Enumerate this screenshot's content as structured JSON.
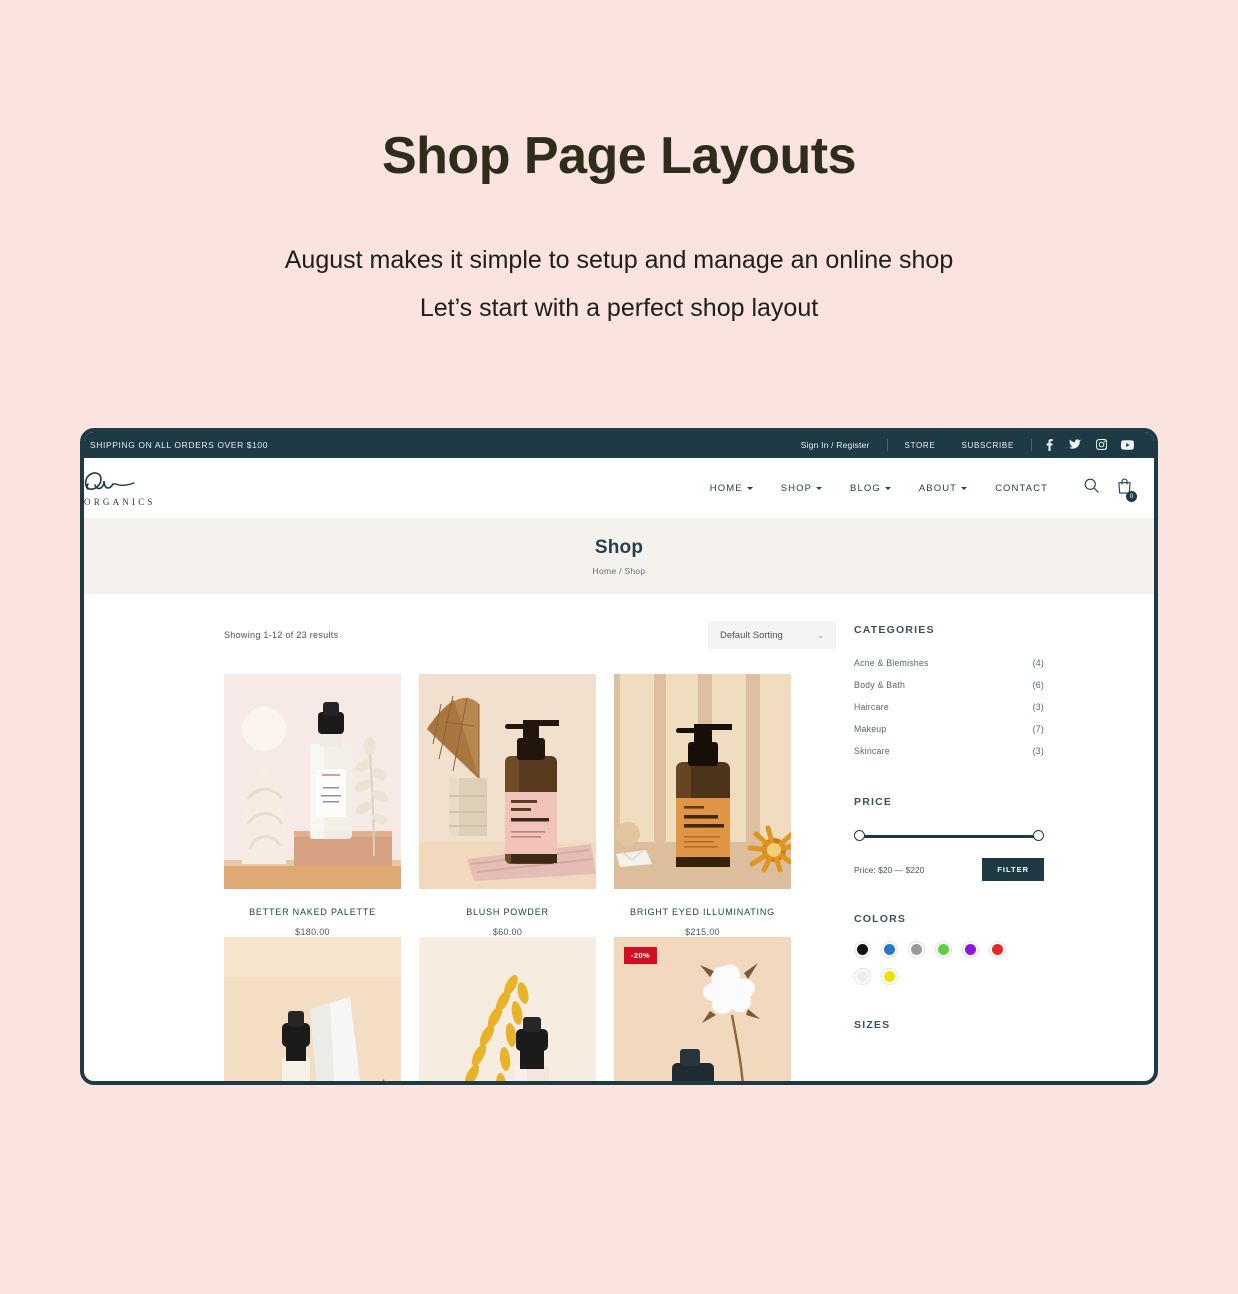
{
  "promo": {
    "title": "Shop Page Layouts",
    "subtitle_line1": "August makes it simple to setup and manage an online shop",
    "subtitle_line2": "Let’s start with a perfect shop layout"
  },
  "topbar": {
    "announcement": "SHIPPING ON ALL ORDERS OVER $100",
    "sign_in": "Sign In / Register",
    "store": "STORE",
    "subscribe": "SUBSCRIBE",
    "social": [
      "facebook-icon",
      "twitter-icon",
      "instagram-icon",
      "youtube-icon"
    ]
  },
  "header": {
    "logo_script": "Our",
    "logo_brand": "ORGANICS",
    "nav": [
      {
        "label": "HOME",
        "has_dropdown": true
      },
      {
        "label": "SHOP",
        "has_dropdown": true
      },
      {
        "label": "BLOG",
        "has_dropdown": true
      },
      {
        "label": "ABOUT",
        "has_dropdown": true
      },
      {
        "label": "CONTACT",
        "has_dropdown": false
      }
    ],
    "search_icon": "search-icon",
    "cart_icon": "shopping-bag-icon",
    "cart_count": "0"
  },
  "banner": {
    "title": "Shop",
    "breadcrumb": "Home / Shop"
  },
  "shop": {
    "results_text": "Showing 1-12 of 23 results",
    "sorting_value": "Default Sorting",
    "sorting_caret": "chevron-down-icon",
    "products": [
      {
        "name": "BETTER NAKED PALETTE",
        "price": "$180.00",
        "badge": ""
      },
      {
        "name": "BLUSH POWDER",
        "price": "$60.00",
        "badge": ""
      },
      {
        "name": "BRIGHT EYED ILLUMINATING",
        "price": "$215.00",
        "badge": ""
      },
      {
        "name": "",
        "price": "",
        "badge": ""
      },
      {
        "name": "",
        "price": "",
        "badge": ""
      },
      {
        "name": "",
        "price": "",
        "badge": "-20%"
      }
    ]
  },
  "sidebar": {
    "categories_title": "CATEGORIES",
    "categories": [
      {
        "label": "Acne & Blemishes",
        "count": "(4)"
      },
      {
        "label": "Body & Bath",
        "count": "(6)"
      },
      {
        "label": "Haircare",
        "count": "(3)"
      },
      {
        "label": "Makeup",
        "count": "(7)"
      },
      {
        "label": "Skincare",
        "count": "(3)"
      }
    ],
    "price_title": "PRICE",
    "price_range_text": "Price: $20 — $220",
    "filter_button": "FILTER",
    "colors_title": "COLORS",
    "colors": [
      {
        "name": "black",
        "hex": "#111111"
      },
      {
        "name": "blue",
        "hex": "#2878c8"
      },
      {
        "name": "gray",
        "hex": "#9a9a9a"
      },
      {
        "name": "green",
        "hex": "#5ecf46"
      },
      {
        "name": "purple",
        "hex": "#9214e0"
      },
      {
        "name": "red",
        "hex": "#e02b28"
      },
      {
        "name": "white",
        "hex": "#ededed"
      },
      {
        "name": "yellow",
        "hex": "#ece400"
      }
    ],
    "sizes_title": "SIZES"
  },
  "theme": {
    "page_background": "#fbe4df",
    "dark": "#1e3a45",
    "banner_bg": "#f5f2ed",
    "sale_badge": "#d10f21",
    "title_color": "#2e2d1c"
  }
}
